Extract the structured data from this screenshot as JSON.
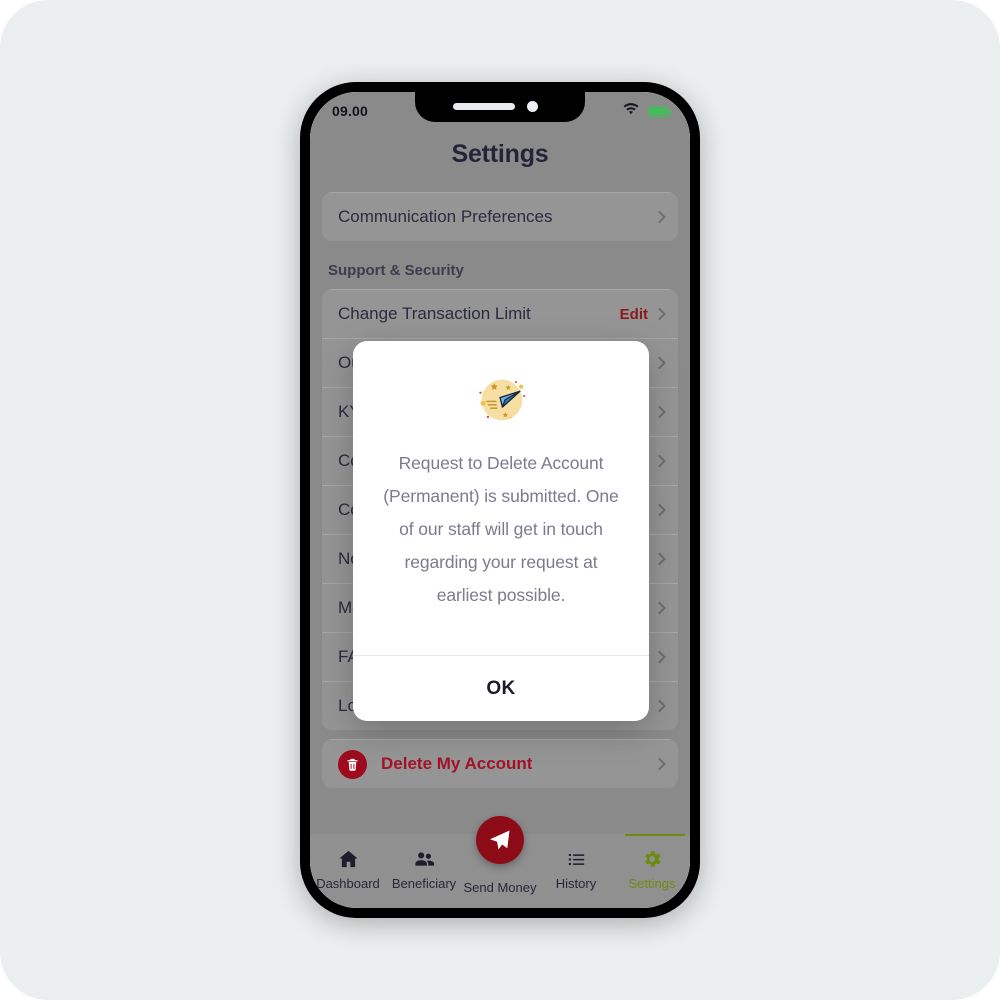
{
  "status_bar": {
    "time": "09.00",
    "wifi_icon": "wifi-icon",
    "battery_icon": "battery-icon",
    "battery_color": "#2ecc4a"
  },
  "header": {
    "title": "Settings"
  },
  "settings": {
    "top_card": [
      {
        "label": "Communication Preferences",
        "trailing": "",
        "chevron": true
      }
    ],
    "section_title": "Support & Security",
    "support_rows": [
      {
        "label": "Change Transaction Limit",
        "trailing": "Edit",
        "chevron": true
      },
      {
        "label": "Our Branches",
        "trailing": "",
        "chevron": true
      },
      {
        "label": "KYC Documents",
        "trailing": "",
        "chevron": true
      },
      {
        "label": "Contact Us",
        "trailing": "",
        "chevron": true
      },
      {
        "label": "Complaints",
        "trailing": "",
        "chevron": true
      },
      {
        "label": "Notifications",
        "trailing": "",
        "chevron": true
      },
      {
        "label": "More Information",
        "trailing": "",
        "chevron": true
      },
      {
        "label": "FAQs",
        "trailing": "",
        "chevron": true
      },
      {
        "label": "Logout",
        "trailing": "",
        "chevron": true
      }
    ],
    "delete_row": {
      "label": "Delete My Account",
      "icon": "trash-icon",
      "icon_background": "#9e0b1e",
      "text_color": "#a4122a",
      "chevron": true
    }
  },
  "modal": {
    "illustration": "paper-plane-icon",
    "message": "Request to Delete Account (Permanent) is submitted. One of our staff will get in touch regarding your request at earliest possible.",
    "ok_label": "OK"
  },
  "tabbar": {
    "active_color": "#6d8a10",
    "fab_color": "#8c0b16",
    "items": [
      {
        "label": "Dashboard",
        "icon": "home-icon",
        "active": false
      },
      {
        "label": "Beneficiary",
        "icon": "people-icon",
        "active": false
      },
      {
        "label": "Send Money",
        "icon": "send-plane-icon",
        "active": false
      },
      {
        "label": "History",
        "icon": "list-icon",
        "active": false
      },
      {
        "label": "Settings",
        "icon": "gear-icon",
        "active": true
      }
    ]
  }
}
